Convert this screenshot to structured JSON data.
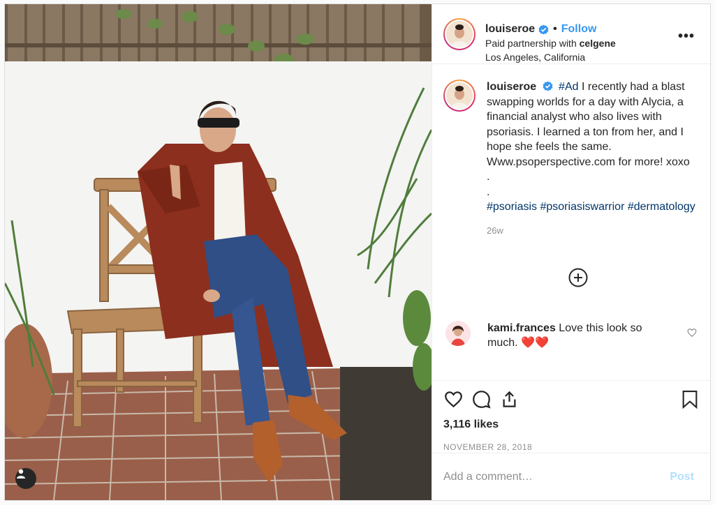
{
  "post": {
    "username": "louiseroe",
    "follow_label": "Follow",
    "separator": "•",
    "partnership_prefix": "Paid partnership with",
    "partner": "celgene",
    "location": "Los Angeles, California",
    "more_icon": "more-horizontal-icon"
  },
  "caption": {
    "username": "louiseroe",
    "hashtag_ad": "#Ad",
    "text": "I recently had a blast swapping worlds for a day with Alycia, a financial analyst who also lives with psoriasis. I learned a ton from her, and I hope she feels the same. Www.psoperspective.com for more! xoxo",
    "dot1": ".",
    "dot2": ".",
    "hashtags": [
      "#psoriasis",
      "#psoriasiswarrior",
      "#dermatology"
    ],
    "time": "26w"
  },
  "comment": {
    "username": "kami.frances",
    "text": "Love this look so much.",
    "emoji": "❤️❤️"
  },
  "actions": {
    "likes": "3,116 likes",
    "date": "NOVEMBER 28, 2018"
  },
  "composer": {
    "placeholder": "Add a comment…",
    "post_label": "Post"
  },
  "colors": {
    "link_blue": "#3897f0",
    "hashtag": "#003569",
    "muted": "#8e8e8e",
    "post_disabled": "#b2dffc"
  }
}
